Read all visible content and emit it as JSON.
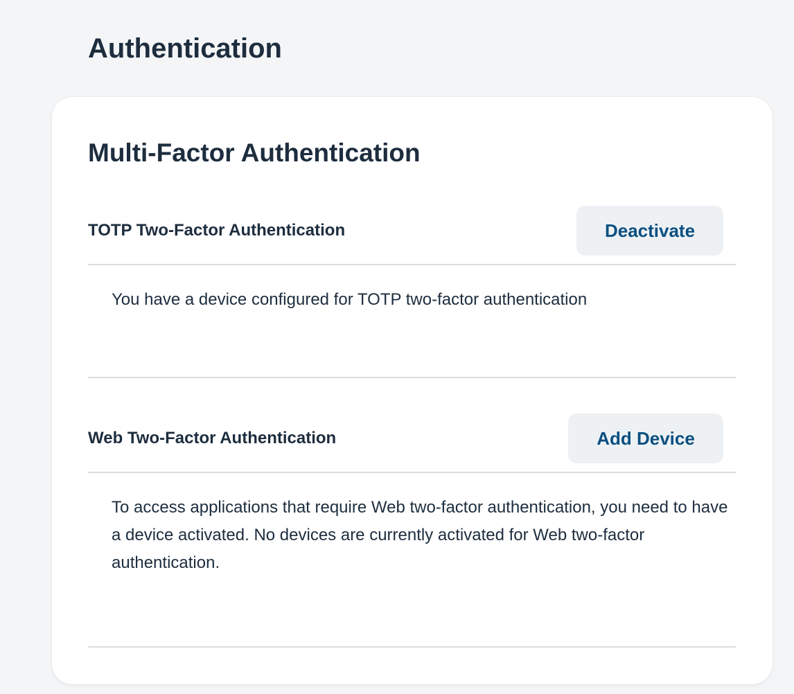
{
  "page": {
    "title": "Authentication"
  },
  "card": {
    "title": "Multi-Factor Authentication"
  },
  "sections": [
    {
      "title": "TOTP Two-Factor Authentication",
      "button_label": "Deactivate",
      "description": "You have a device configured for TOTP two-factor authentication"
    },
    {
      "title": "Web Two-Factor Authentication",
      "button_label": "Add Device",
      "description": "To access applications that require Web two-factor authentication, you need to have a device activated. No devices are currently activated for Web two-factor authentication."
    }
  ],
  "colors": {
    "background": "#f4f5f6",
    "card": "#ffffff",
    "text": "#1d2d3e",
    "button_text": "#0a4f80",
    "button_bg": "#eef1f4",
    "divider": "#d9dcdf"
  }
}
